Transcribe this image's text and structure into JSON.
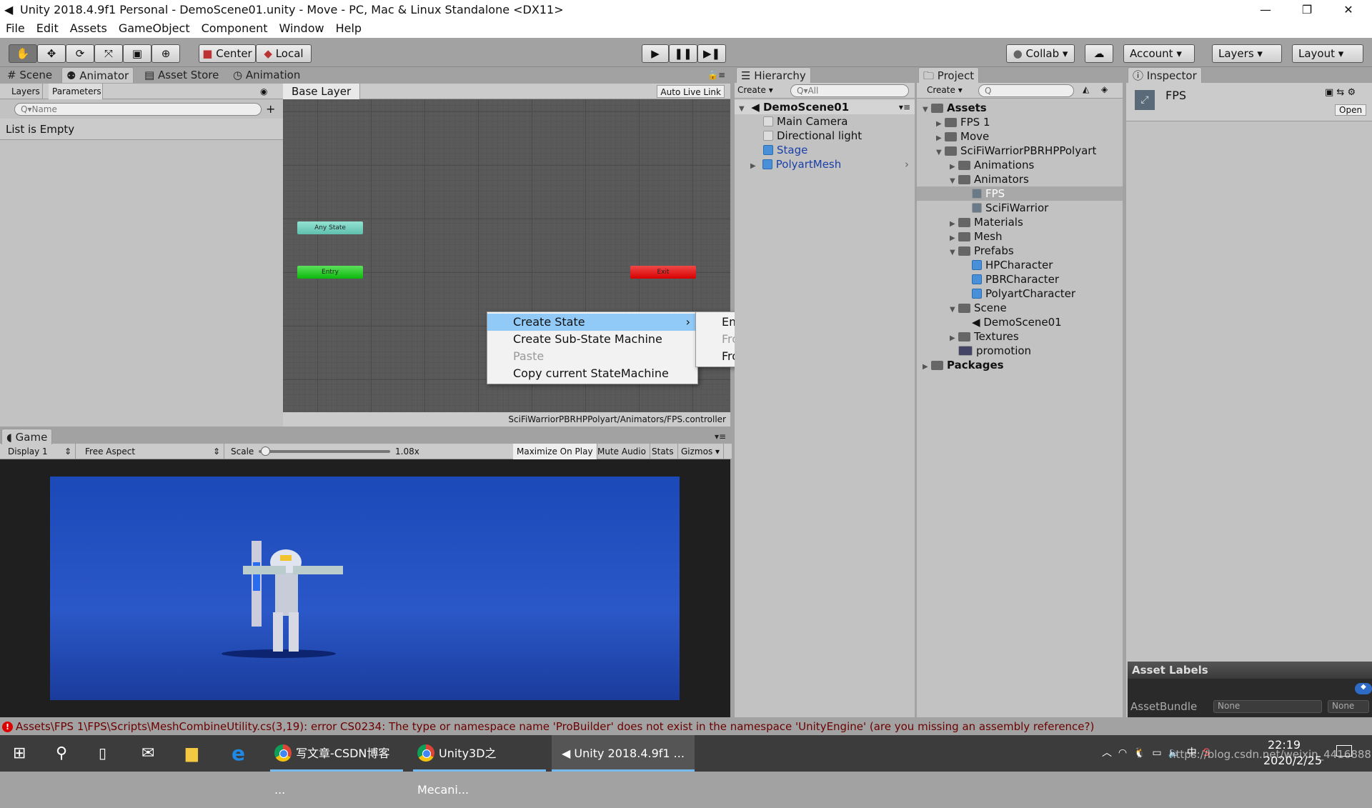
{
  "window": {
    "title": "Unity 2018.4.9f1 Personal - DemoScene01.unity - Move - PC, Mac & Linux Standalone <DX11>",
    "minimize": "—",
    "restore": "❐",
    "close": "✕"
  },
  "menu": [
    "File",
    "Edit",
    "Assets",
    "GameObject",
    "Component",
    "Window",
    "Help"
  ],
  "toolbar": {
    "tools": [
      "hand-tool",
      "move-tool",
      "rotate-tool",
      "scale-tool",
      "rect-tool",
      "transform-tool"
    ],
    "pivot": "Center",
    "space": "Local",
    "collab": "Collab ▾",
    "account": "Account",
    "layers": "Layers",
    "layout": "Layout"
  },
  "tabs": {
    "scene": "Scene",
    "animator": "Animator",
    "asset_store": "Asset Store",
    "animation": "Animation"
  },
  "animator": {
    "layers_tab": "Layers",
    "parameters_tab": "Parameters",
    "search_placeholder": "Name",
    "list_empty": "List is Empty",
    "breadcrumb": "Base Layer",
    "auto_live_link": "Auto Live Link",
    "path": "SciFiWarriorPBRHPPolyart/Animators/FPS.controller",
    "states": {
      "any": "Any State",
      "entry": "Entry",
      "exit": "Exit"
    },
    "colors": {
      "any": "#7fd6c4",
      "entry": "#1ec61e",
      "exit": "#e01010"
    }
  },
  "context_menu": {
    "items": [
      {
        "label": "Create State",
        "highlighted": true,
        "submenu": true
      },
      {
        "label": "Create Sub-State Machine"
      },
      {
        "label": "Paste",
        "disabled": true
      },
      {
        "label": "Copy current StateMachine"
      }
    ],
    "submenu": [
      {
        "label": "Empty"
      },
      {
        "label": "From Selected Clip",
        "disabled": true
      },
      {
        "label": "From New Blend Tree"
      }
    ]
  },
  "hierarchy": {
    "tab": "Hierarchy",
    "create": "Create ▾",
    "search_placeholder": "All",
    "scene": "DemoScene01",
    "items": [
      {
        "label": "Main Camera"
      },
      {
        "label": "Directional light"
      },
      {
        "label": "Stage",
        "prefab": true
      },
      {
        "label": "PolyartMesh",
        "prefab": true,
        "expandable": true
      }
    ]
  },
  "project": {
    "tab": "Project",
    "create": "Create ▾",
    "tree": [
      {
        "label": "Assets",
        "depth": 0,
        "fold": "▼",
        "bold": true,
        "type": "folder"
      },
      {
        "label": "FPS 1",
        "depth": 1,
        "fold": "▶",
        "type": "folder"
      },
      {
        "label": "Move",
        "depth": 1,
        "fold": "▶",
        "type": "folder"
      },
      {
        "label": "SciFiWarriorPBRHPPolyart",
        "depth": 1,
        "fold": "▼",
        "type": "folder"
      },
      {
        "label": "Animations",
        "depth": 2,
        "fold": "▶",
        "type": "folder"
      },
      {
        "label": "Animators",
        "depth": 2,
        "fold": "▼",
        "type": "folder"
      },
      {
        "label": "FPS",
        "depth": 3,
        "fold": "",
        "type": "controller",
        "selected": true
      },
      {
        "label": "SciFiWarrior",
        "depth": 3,
        "fold": "",
        "type": "controller"
      },
      {
        "label": "Materials",
        "depth": 2,
        "fold": "▶",
        "type": "folder"
      },
      {
        "label": "Mesh",
        "depth": 2,
        "fold": "▶",
        "type": "folder"
      },
      {
        "label": "Prefabs",
        "depth": 2,
        "fold": "▼",
        "type": "folder"
      },
      {
        "label": "HPCharacter",
        "depth": 3,
        "fold": "",
        "type": "prefab"
      },
      {
        "label": "PBRCharacter",
        "depth": 3,
        "fold": "",
        "type": "prefab"
      },
      {
        "label": "PolyartCharacter",
        "depth": 3,
        "fold": "",
        "type": "prefab"
      },
      {
        "label": "Scene",
        "depth": 2,
        "fold": "▼",
        "type": "folder"
      },
      {
        "label": "DemoScene01",
        "depth": 3,
        "fold": "",
        "type": "scene"
      },
      {
        "label": "Textures",
        "depth": 2,
        "fold": "▶",
        "type": "folder"
      },
      {
        "label": "promotion",
        "depth": 2,
        "fold": "",
        "type": "image"
      },
      {
        "label": "Packages",
        "depth": 0,
        "fold": "▶",
        "bold": true,
        "type": "folder"
      }
    ]
  },
  "inspector": {
    "tab": "Inspector",
    "asset_name": "FPS",
    "open": "Open",
    "asset_labels": "Asset Labels",
    "assetbundle_label": "AssetBundle",
    "bundle": "None",
    "variant": "None"
  },
  "game": {
    "tab": "Game",
    "display": "Display 1",
    "aspect": "Free Aspect",
    "scale_label": "Scale",
    "scale_value": "1.08x",
    "scale_fraction": 0.05,
    "maximize": "Maximize On Play",
    "mute": "Mute Audio",
    "stats": "Stats",
    "gizmos": "Gizmos"
  },
  "status": {
    "error": "Assets\\FPS 1\\FPS\\Scripts\\MeshCombineUtility.cs(3,19): error CS0234: The type or namespace name 'ProBuilder' does not exist in the namespace 'UnityEngine' (are you missing an assembly reference?)"
  },
  "taskbar": {
    "apps": [
      "写文章-CSDN博客 ...",
      "Unity3D之Mecani...",
      "Unity 2018.4.9f1 ..."
    ],
    "time": "22:19",
    "date": "2020/2/25",
    "watermark": "https://blog.csdn.net/weixin_44168889"
  }
}
